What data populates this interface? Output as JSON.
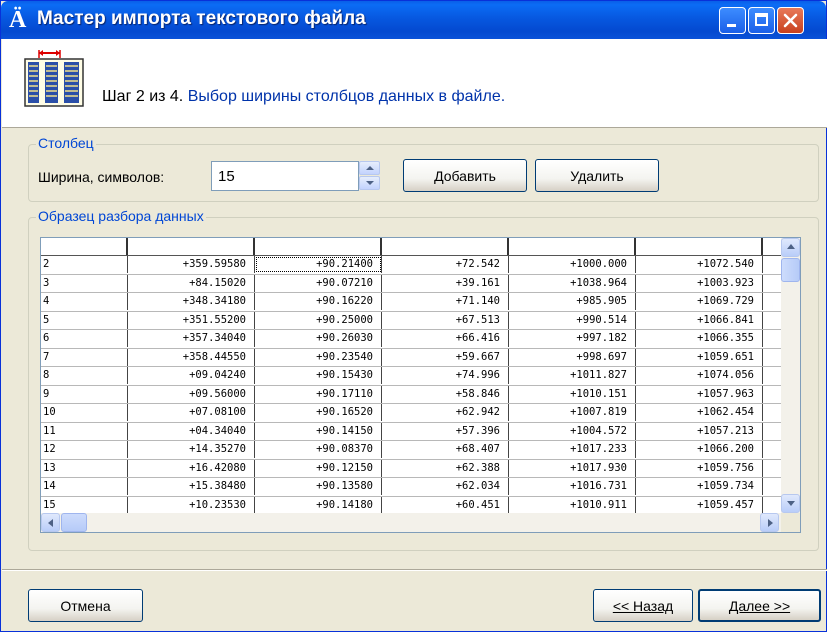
{
  "window": {
    "title": "Мастер импорта текстового файла",
    "icon": "text-import-wizard-icon",
    "controls": [
      "minimize-icon",
      "maximize-icon",
      "close-icon"
    ]
  },
  "header": {
    "step": "Шаг 2 из 4.",
    "description": "Выбор ширины столбцов данных в файле.",
    "icon": "column-width-icon"
  },
  "column_group": {
    "legend": "Столбец",
    "width_label": "Ширина, символов:",
    "width_value": "15",
    "add_button": "Добавить",
    "delete_button": "Удалить"
  },
  "sample_group": {
    "legend": "Образец разбора данных",
    "rows": [
      [
        "2",
        "+359.59580",
        "+90.21400",
        "+72.542",
        "+1000.000",
        "+1072.540"
      ],
      [
        "3",
        "+84.15020",
        "+90.07210",
        "+39.161",
        "+1038.964",
        "+1003.923"
      ],
      [
        "4",
        "+348.34180",
        "+90.16220",
        "+71.140",
        "+985.905",
        "+1069.729"
      ],
      [
        "5",
        "+351.55200",
        "+90.25000",
        "+67.513",
        "+990.514",
        "+1066.841"
      ],
      [
        "6",
        "+357.34040",
        "+90.26030",
        "+66.416",
        "+997.182",
        "+1066.355"
      ],
      [
        "7",
        "+358.44550",
        "+90.23540",
        "+59.667",
        "+998.697",
        "+1059.651"
      ],
      [
        "8",
        "+09.04240",
        "+90.15430",
        "+74.996",
        "+1011.827",
        "+1074.056"
      ],
      [
        "9",
        "+09.56000",
        "+90.17110",
        "+58.846",
        "+1010.151",
        "+1057.963"
      ],
      [
        "10",
        "+07.08100",
        "+90.16520",
        "+62.942",
        "+1007.819",
        "+1062.454"
      ],
      [
        "11",
        "+04.34040",
        "+90.14150",
        "+57.396",
        "+1004.572",
        "+1057.213"
      ],
      [
        "12",
        "+14.35270",
        "+90.08370",
        "+68.407",
        "+1017.233",
        "+1066.200"
      ],
      [
        "13",
        "+16.42080",
        "+90.12150",
        "+62.388",
        "+1017.930",
        "+1059.756"
      ],
      [
        "14",
        "+15.38480",
        "+90.13580",
        "+62.034",
        "+1016.731",
        "+1059.734"
      ],
      [
        "15",
        "+10.23530",
        "+90.14180",
        "+60.451",
        "+1010.911",
        "+1059.457"
      ]
    ]
  },
  "footer": {
    "cancel_button": "Отмена",
    "back_button": "<< Назад",
    "next_button": "Далее >>"
  }
}
